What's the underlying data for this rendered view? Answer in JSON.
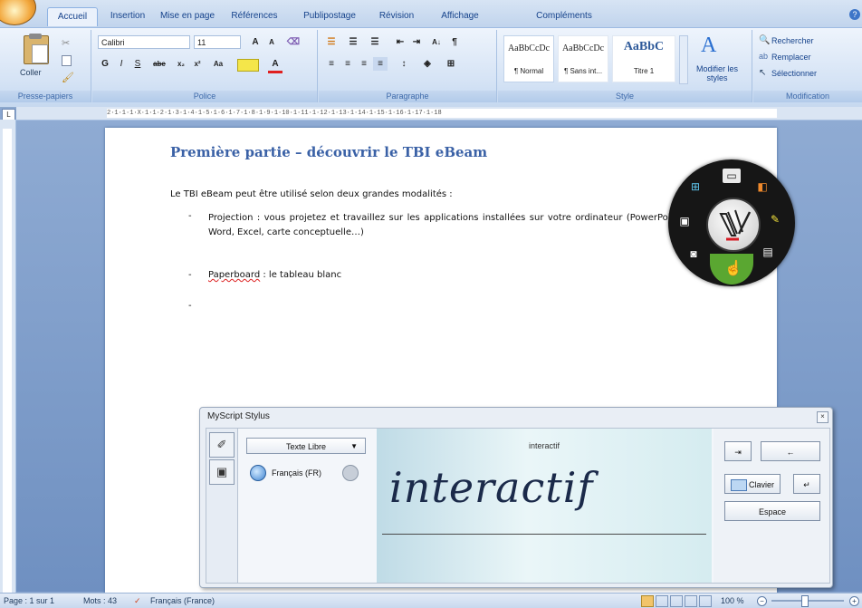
{
  "ribbon": {
    "tabs": [
      "Accueil",
      "Insertion",
      "Mise en page",
      "Références",
      "Publipostage",
      "Révision",
      "Affichage",
      "Compléments"
    ],
    "clipboard": {
      "paste_label": "Coller",
      "group_label": "Presse-papiers"
    },
    "font": {
      "name": "Calibri",
      "size": "11",
      "group_label": "Police"
    },
    "paragraph": {
      "group_label": "Paragraphe"
    },
    "styles": {
      "items": [
        {
          "sample": "AaBbCcDc",
          "name": "¶ Normal"
        },
        {
          "sample": "AaBbCcDc",
          "name": "¶ Sans int..."
        },
        {
          "sample": "AaBbC",
          "name": "Titre 1"
        }
      ],
      "modify_label": "Modifier les styles",
      "group_label": "Style"
    },
    "editing": {
      "find": "Rechercher",
      "replace": "Remplacer",
      "select": "Sélectionner",
      "group_label": "Modification"
    }
  },
  "ruler": {
    "numbers": "2·1·1·1·X·1·1·2·1·3·1·4·1·5·1·6·1·7·1·8·1·9·1·10·1·11·1·12·1·13·1·14·1·15·1·16·1·17·1·18"
  },
  "document": {
    "title": "Première partie – découvrir le TBI eBeam",
    "intro": "Le TBI eBeam peut être utilisé selon deux grandes modalités :",
    "bullet1": "Projection : vous projetez et travaillez sur les applications installées sur votre ordinateur (PowerPoint, Word, Excel, carte conceptuelle…)",
    "bullet2_word": "Paperboard",
    "bullet2_rest": " : le tableau blanc",
    "dash": "-"
  },
  "myscript": {
    "title": "MyScript Stylus",
    "mode": "Texte Libre",
    "language": "Français (FR)",
    "recognized": "interactif",
    "ink": "interactif",
    "keyboard": "Clavier",
    "space": "Espace"
  },
  "status": {
    "page": "Page : 1 sur 1",
    "words": "Mots : 43",
    "language": "Français (France)",
    "zoom": "100 %"
  }
}
